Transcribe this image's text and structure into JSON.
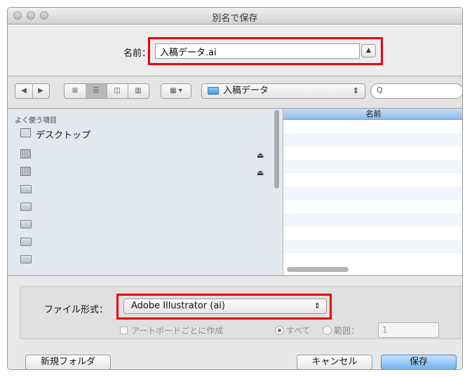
{
  "window": {
    "title": "別名で保存"
  },
  "save_as": {
    "label": "名前：",
    "value": "入稿データ.ai",
    "expand_glyph": "▲"
  },
  "toolbar": {
    "back_glyph": "◀",
    "forward_glyph": "▶",
    "view_icon_glyph": "⊞",
    "view_list_glyph": "☰",
    "view_column_glyph": "◫",
    "view_coverflow_glyph": "▥",
    "arrange_glyph": "▦ ▾",
    "location": "入稿データ",
    "location_arrows": "⇕",
    "search_glyph": "Q"
  },
  "sidebar": {
    "header": "よく使う項目",
    "items": [
      {
        "label": "デスクトップ",
        "icon": "desktop-icon"
      },
      {
        "label": "",
        "icon": "drive-icon",
        "eject": "⏏"
      },
      {
        "label": "",
        "icon": "drive-icon",
        "eject": "⏏"
      },
      {
        "label": "",
        "icon": "folder-icon"
      },
      {
        "label": "",
        "icon": "folder-icon"
      },
      {
        "label": "",
        "icon": "folder-icon"
      },
      {
        "label": "",
        "icon": "folder-icon"
      },
      {
        "label": "",
        "icon": "folder-icon"
      }
    ]
  },
  "file_list": {
    "column_header": "名前"
  },
  "format": {
    "label": "ファイル形式：",
    "value": "Adobe Illustrator (ai)",
    "arrows": "⇕",
    "artboard_checkbox": "アートボードごとに作成",
    "radio_all": "すべて",
    "radio_range": "範囲：",
    "range_value": "1"
  },
  "buttons": {
    "new_folder": "新規フォルダ",
    "cancel": "キャンセル",
    "save": "保存"
  },
  "colors": {
    "highlight_box": "#e60012",
    "save_button": "#6fb3f0",
    "column_header": "#a9cdf1"
  }
}
